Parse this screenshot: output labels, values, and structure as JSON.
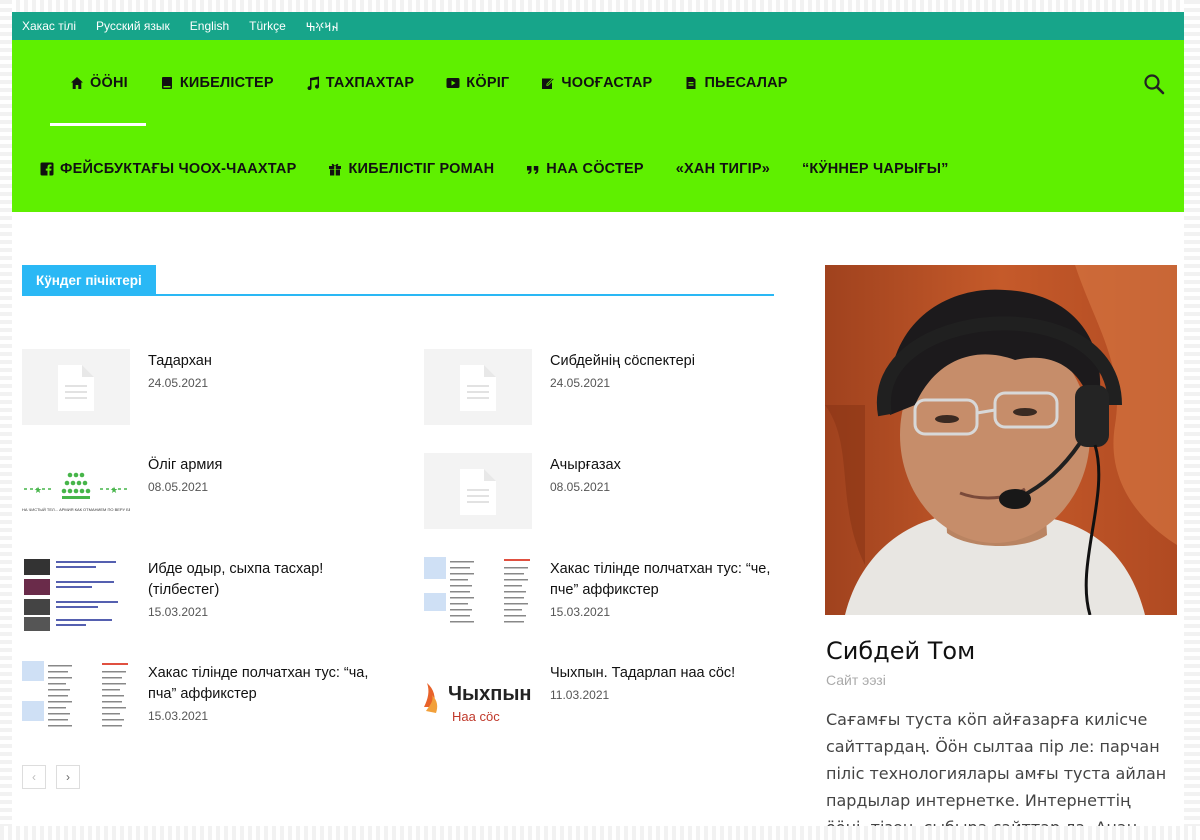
{
  "languages": [
    "Хакас тілі",
    "Русский язык",
    "English",
    "Türkçe",
    "𐰴𐰺𐰍𐰕"
  ],
  "menu_row1": [
    {
      "label": "ӦӦНІ",
      "icon": "home-icon"
    },
    {
      "label": "КИБЕЛІСТЕР",
      "icon": "book-icon"
    },
    {
      "label": "ТАХПАХТАР",
      "icon": "music-icon"
    },
    {
      "label": "КӦРІГ",
      "icon": "play-icon"
    },
    {
      "label": "ЧООҒАСТАР",
      "icon": "edit-icon"
    },
    {
      "label": "ПЬЕСАЛАР",
      "icon": "file-text-icon"
    }
  ],
  "menu_row2": [
    {
      "label": "ФЕЙСБУКТАҒЫ ЧООХ-ЧААХТАР",
      "icon": "facebook-icon"
    },
    {
      "label": "КИБЕЛІСТІГ РОМАН",
      "icon": "gift-icon"
    },
    {
      "label": "НАА СӦСТЕР",
      "icon": "quote-icon"
    },
    {
      "label": "«ХАН ТИГІР»",
      "icon": ""
    },
    {
      "label": "“КӰННЕР ЧАРЫҒЫ”",
      "icon": ""
    }
  ],
  "section": {
    "title": "Кӱндег пічіктері"
  },
  "posts": [
    {
      "title": "Тадархан",
      "date": "24.05.2021"
    },
    {
      "title": "Сибдейнің сӧспектері",
      "date": "24.05.2021"
    },
    {
      "title": "Ӧліг армия",
      "date": "08.05.2021"
    },
    {
      "title": "Ачырғазах",
      "date": "08.05.2021"
    },
    {
      "title": "Ибде одыр, сыхпа тасхар! (тілбестег)",
      "date": "15.03.2021"
    },
    {
      "title": "Хакас тілінде полчатхан тус: “че, пче” аффикстер",
      "date": "15.03.2021"
    },
    {
      "title": "Хакас тілінде полчатхан тус: “ча, пча” аффикстер",
      "date": "15.03.2021"
    },
    {
      "title": "Чыхпын. Тадарлап наа сӧс!",
      "date": "11.03.2021"
    }
  ],
  "thumb_text": {
    "army": "НА ЧИСТЫЙ ТЕЛ... АРМИЯ КАК ОТМАНИЕМ ПО ВЕРУ БЕЗЖИВ",
    "chyhpyn_big": "Чыхпын",
    "chyhpyn_small": "Наа сӧс"
  },
  "pager": {
    "prev": "‹",
    "next": "›"
  },
  "author": {
    "name": "Сибдей Том",
    "role": "Сайт ээзі",
    "description": "Сағамғы туста кӧп айғазарға килісче сайттардаң. Ӧӧн сылтаа пір ле: парчан піліс технологиялары амғы туста айлан пардылар интернетке. Интернеттің ӧӧні, тізең, сыбыра сайттар ла. Анаң пасха ниме"
  },
  "colors": {
    "topbar": "#17a58a",
    "header": "#5ff000",
    "accent": "#2ab8f5"
  }
}
